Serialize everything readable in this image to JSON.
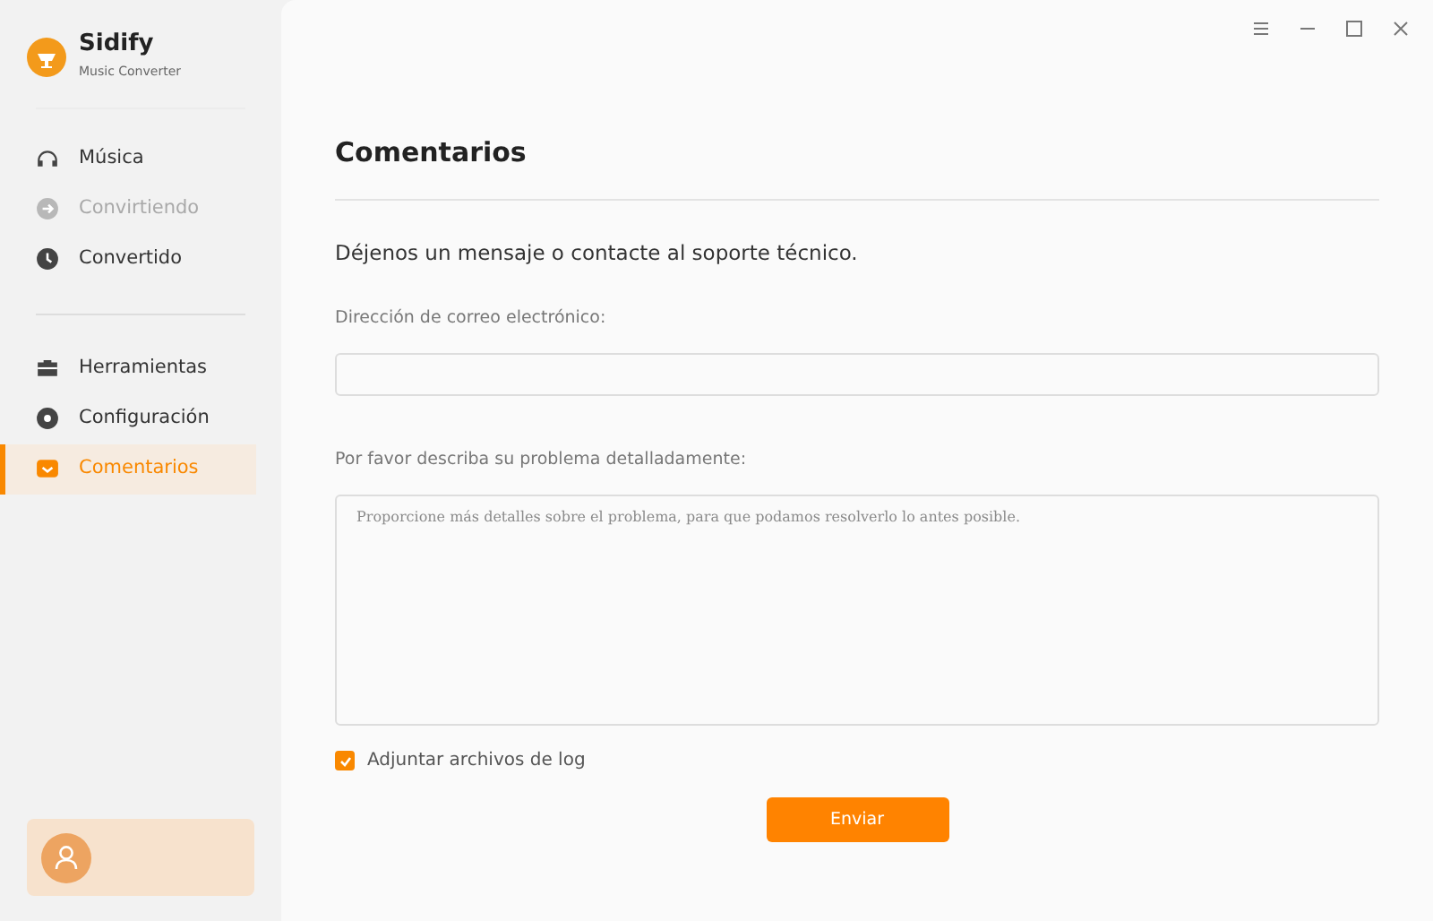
{
  "app": {
    "name": "Sidify",
    "subtitle": "Music Converter"
  },
  "sidebar": {
    "groups": [
      [
        {
          "label": "Música",
          "kind": "headphones",
          "selected": false,
          "disabled": false
        },
        {
          "label": "Convirtiendo",
          "kind": "convert",
          "selected": false,
          "disabled": true
        },
        {
          "label": "Convertido",
          "kind": "clock",
          "selected": false,
          "disabled": false
        }
      ],
      [
        {
          "label": "Herramientas",
          "kind": "toolbox",
          "selected": false,
          "disabled": false
        },
        {
          "label": "Configuración",
          "kind": "gear",
          "selected": false,
          "disabled": false
        },
        {
          "label": "Comentarios",
          "kind": "mail",
          "selected": true,
          "disabled": false
        }
      ]
    ]
  },
  "page": {
    "title": "Comentarios",
    "intro": "Déjenos un mensaje o contacte al soporte técnico.",
    "email_label": "Dirección de correo electrónico:",
    "problem_label": "Por favor describa su problema detalladamente:",
    "problem_placeholder": "Proporcione más detalles sobre el problema, para que podamos resolverlo lo antes posible.",
    "attach": {
      "label": "Adjuntar archivos de log",
      "checked": true
    },
    "submit": "Enviar"
  }
}
